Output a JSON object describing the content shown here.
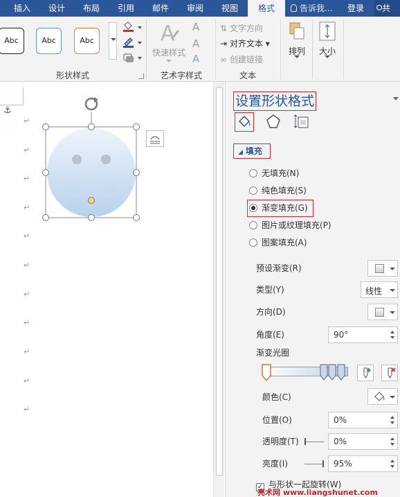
{
  "ribbon_tabs": [
    "插入",
    "设计",
    "布局",
    "引用",
    "邮件",
    "审阅",
    "视图",
    "格式"
  ],
  "tell_me": "告诉我...",
  "login": "登录",
  "share": "共",
  "groups": {
    "shape_styles": {
      "label": "形状样式",
      "samples": [
        "Abc",
        "Abc",
        "Abc"
      ]
    },
    "wordart": {
      "label": "艺术字样式",
      "quick_styles": "快速样式",
      "letters": [
        "A",
        "A",
        "A"
      ]
    },
    "text": {
      "label": "文本",
      "direction": "文字方向",
      "align": "对齐文本",
      "link": "创建链接"
    },
    "arrange": {
      "label": "排列"
    },
    "size": {
      "label": "大小"
    }
  },
  "document": {
    "return_marks": [
      "↵",
      "↵",
      "↵",
      "↵",
      "↵",
      "↵",
      "↵",
      "↵",
      "↵",
      "↵",
      "↵",
      "↵"
    ]
  },
  "pane": {
    "title": "设置形状格式",
    "section": "填充",
    "options": [
      "无填充(N)",
      "纯色填充(S)",
      "渐变填充(G)",
      "图片或纹理填充(P)",
      "图案填充(A)"
    ],
    "selected_option": "渐变填充(G)",
    "preset_label": "预设渐变(R)",
    "type_label": "类型(Y)",
    "type_value": "线性",
    "direction_label": "方向(D)",
    "angle_label": "角度(E)",
    "angle_value": "90°",
    "stops_label": "渐变光圈",
    "color_label": "颜色(C)",
    "position_label": "位置(O)",
    "position_value": "0%",
    "transparency_label": "透明度(T)",
    "transparency_value": "0%",
    "brightness_label": "亮度(I)",
    "brightness_value": "95%",
    "rotate_label": "与形状一起旋转(W)"
  },
  "watermark": "亮术网 www.liangshunet.com",
  "colors": {
    "accent": "#2b579a",
    "highlight": "#e0262b",
    "ribbon": "#f3f3f3"
  }
}
